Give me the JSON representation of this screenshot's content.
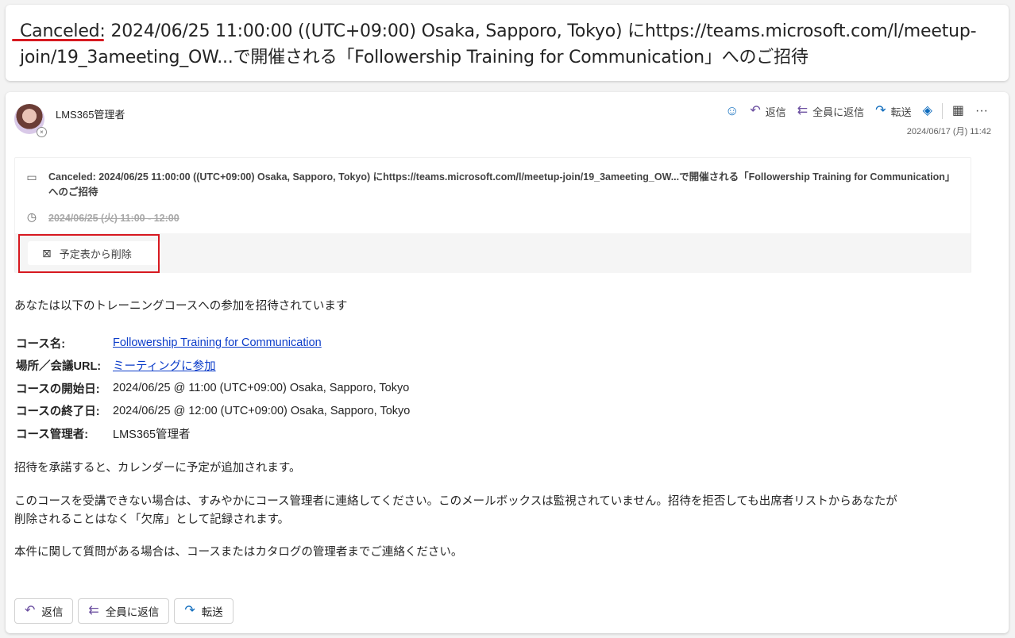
{
  "subject": {
    "canceled_label": "Canceled:",
    "text": " 2024/06/25 11:00:00 ((UTC+09:00) Osaka, Sapporo, Tokyo) にhttps://teams.microsoft.com/l/meetup-join/19_3ameeting_OW...で開催される「Followership Training for Communication」へのご招待"
  },
  "sender": {
    "name": "LMS365管理者",
    "timestamp": "2024/06/17 (月) 11:42"
  },
  "toolbar": {
    "reply": "返信",
    "reply_all": "全員に返信",
    "forward": "転送"
  },
  "event": {
    "title": "Canceled: 2024/06/25 11:00:00 ((UTC+09:00) Osaka, Sapporo, Tokyo) にhttps://teams.microsoft.com/l/meetup-join/19_3ameeting_OW...で開催される「Followership Training for Communication」へのご招待",
    "time": "2024/06/25 (火) 11:00 - 12:00",
    "remove_label": "予定表から削除"
  },
  "body": {
    "intro": "あなたは以下のトレーニングコースへの参加を招待されています",
    "rows": [
      {
        "label": "コース名:",
        "value": "Followership Training for Communication"
      },
      {
        "label": "場所／会議URL:",
        "value": "ミーティングに参加"
      },
      {
        "label": "コースの開始日:",
        "value": "2024/06/25 @ 11:00 (UTC+09:00) Osaka, Sapporo, Tokyo"
      },
      {
        "label": "コースの終了日:",
        "value": "2024/06/25 @ 12:00 (UTC+09:00) Osaka, Sapporo, Tokyo"
      },
      {
        "label": "コース管理者:",
        "value": "LMS365管理者"
      }
    ],
    "para1": "招待を承諾すると、カレンダーに予定が追加されます。",
    "para2_line1": "このコースを受講できない場合は、すみやかにコース管理者に連絡してください。このメールボックスは監視されていません。招待を拒否しても出席者リストからあなたが",
    "para2_line2": "削除されることはなく「欠席」として記録されます。",
    "para3": "本件に関して質問がある場合は、コースまたはカタログの管理者までご連絡ください。"
  },
  "bottom_actions": {
    "reply": "返信",
    "reply_all": "全員に返信",
    "forward": "転送"
  },
  "colors": {
    "highlight": "#d71920",
    "link": "#0b3cc9",
    "accent": "#0f6cbd"
  }
}
